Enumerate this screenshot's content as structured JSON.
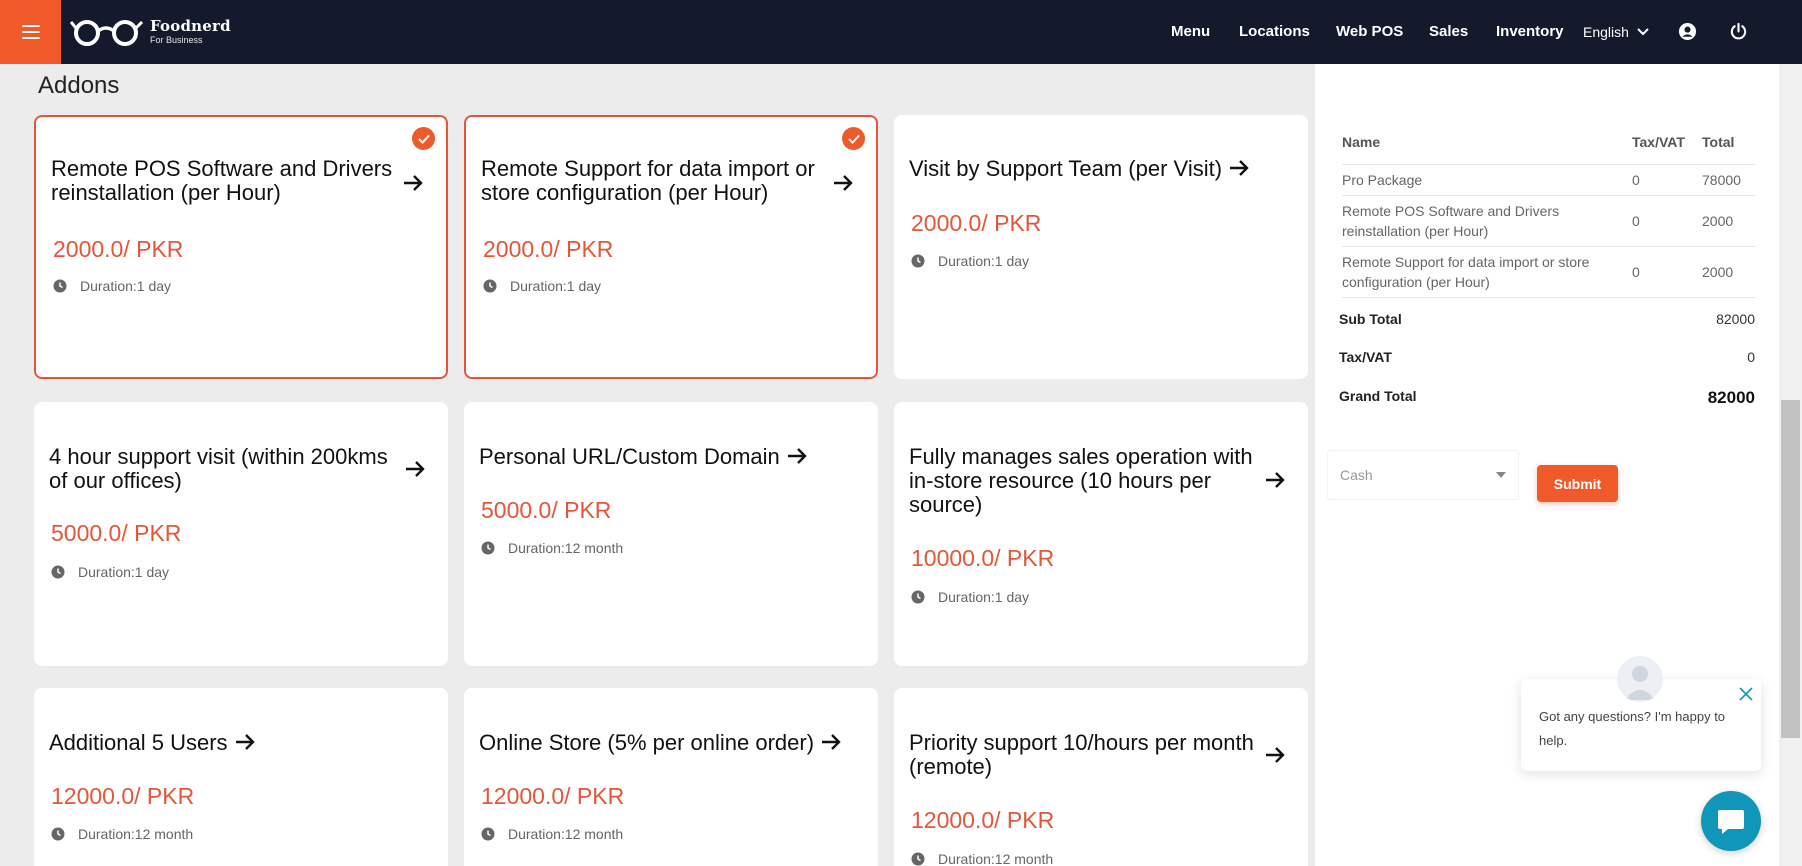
{
  "header": {
    "brand_name": "Foodnerd",
    "brand_sub": "For Business",
    "nav": [
      "Menu",
      "Locations",
      "Web POS",
      "Sales",
      "Inventory"
    ],
    "language": "English",
    "accent": "#f05a2a",
    "background": "#141a2c"
  },
  "addons": {
    "title": "Addons",
    "cards": [
      {
        "title": "Remote POS Software and Drivers reinstallation (per Hour)",
        "price": "2000.0/ PKR",
        "duration": "Duration:1 day",
        "selected": true
      },
      {
        "title": "Remote Support for data import or store configuration (per Hour)",
        "price": "2000.0/ PKR",
        "duration": "Duration:1 day",
        "selected": true
      },
      {
        "title": "Visit by Support Team (per Visit)",
        "price": "2000.0/ PKR",
        "duration": "Duration:1 day",
        "selected": false
      },
      {
        "title": "4 hour support visit (within 200kms of our offices)",
        "price": "5000.0/ PKR",
        "duration": "Duration:1 day",
        "selected": false
      },
      {
        "title": "Personal URL/Custom Domain",
        "price": "5000.0/ PKR",
        "duration": "Duration:12 month",
        "selected": false
      },
      {
        "title": "Fully manages sales operation with in-store resource (10 hours per source)",
        "price": "10000.0/ PKR",
        "duration": "Duration:1 day",
        "selected": false
      },
      {
        "title": "Additional 5 Users",
        "price": "12000.0/ PKR",
        "duration": "Duration:12 month",
        "selected": false
      },
      {
        "title": "Online Store (5% per online order)",
        "price": "12000.0/ PKR",
        "duration": "Duration:12 month",
        "selected": false
      },
      {
        "title": "Priority support 10/hours per month (remote)",
        "price": "12000.0/ PKR",
        "duration": "Duration:12 month",
        "selected": false
      }
    ]
  },
  "summary": {
    "headers": {
      "name": "Name",
      "tax": "Tax/VAT",
      "total": "Total"
    },
    "rows": [
      {
        "name": "Pro Package",
        "tax": "0",
        "total": "78000"
      },
      {
        "name": "Remote POS Software and Drivers reinstallation (per Hour)",
        "tax": "0",
        "total": "2000"
      },
      {
        "name": "Remote Support for data import or store configuration (per Hour)",
        "tax": "0",
        "total": "2000"
      }
    ],
    "sub_total_label": "Sub Total",
    "sub_total": "82000",
    "tax_label": "Tax/VAT",
    "tax": "0",
    "grand_total_label": "Grand Total",
    "grand_total": "82000"
  },
  "payment": {
    "placeholder": "Cash",
    "submit_label": "Submit"
  },
  "chat": {
    "message": "Got any questions? I'm happy to help."
  }
}
